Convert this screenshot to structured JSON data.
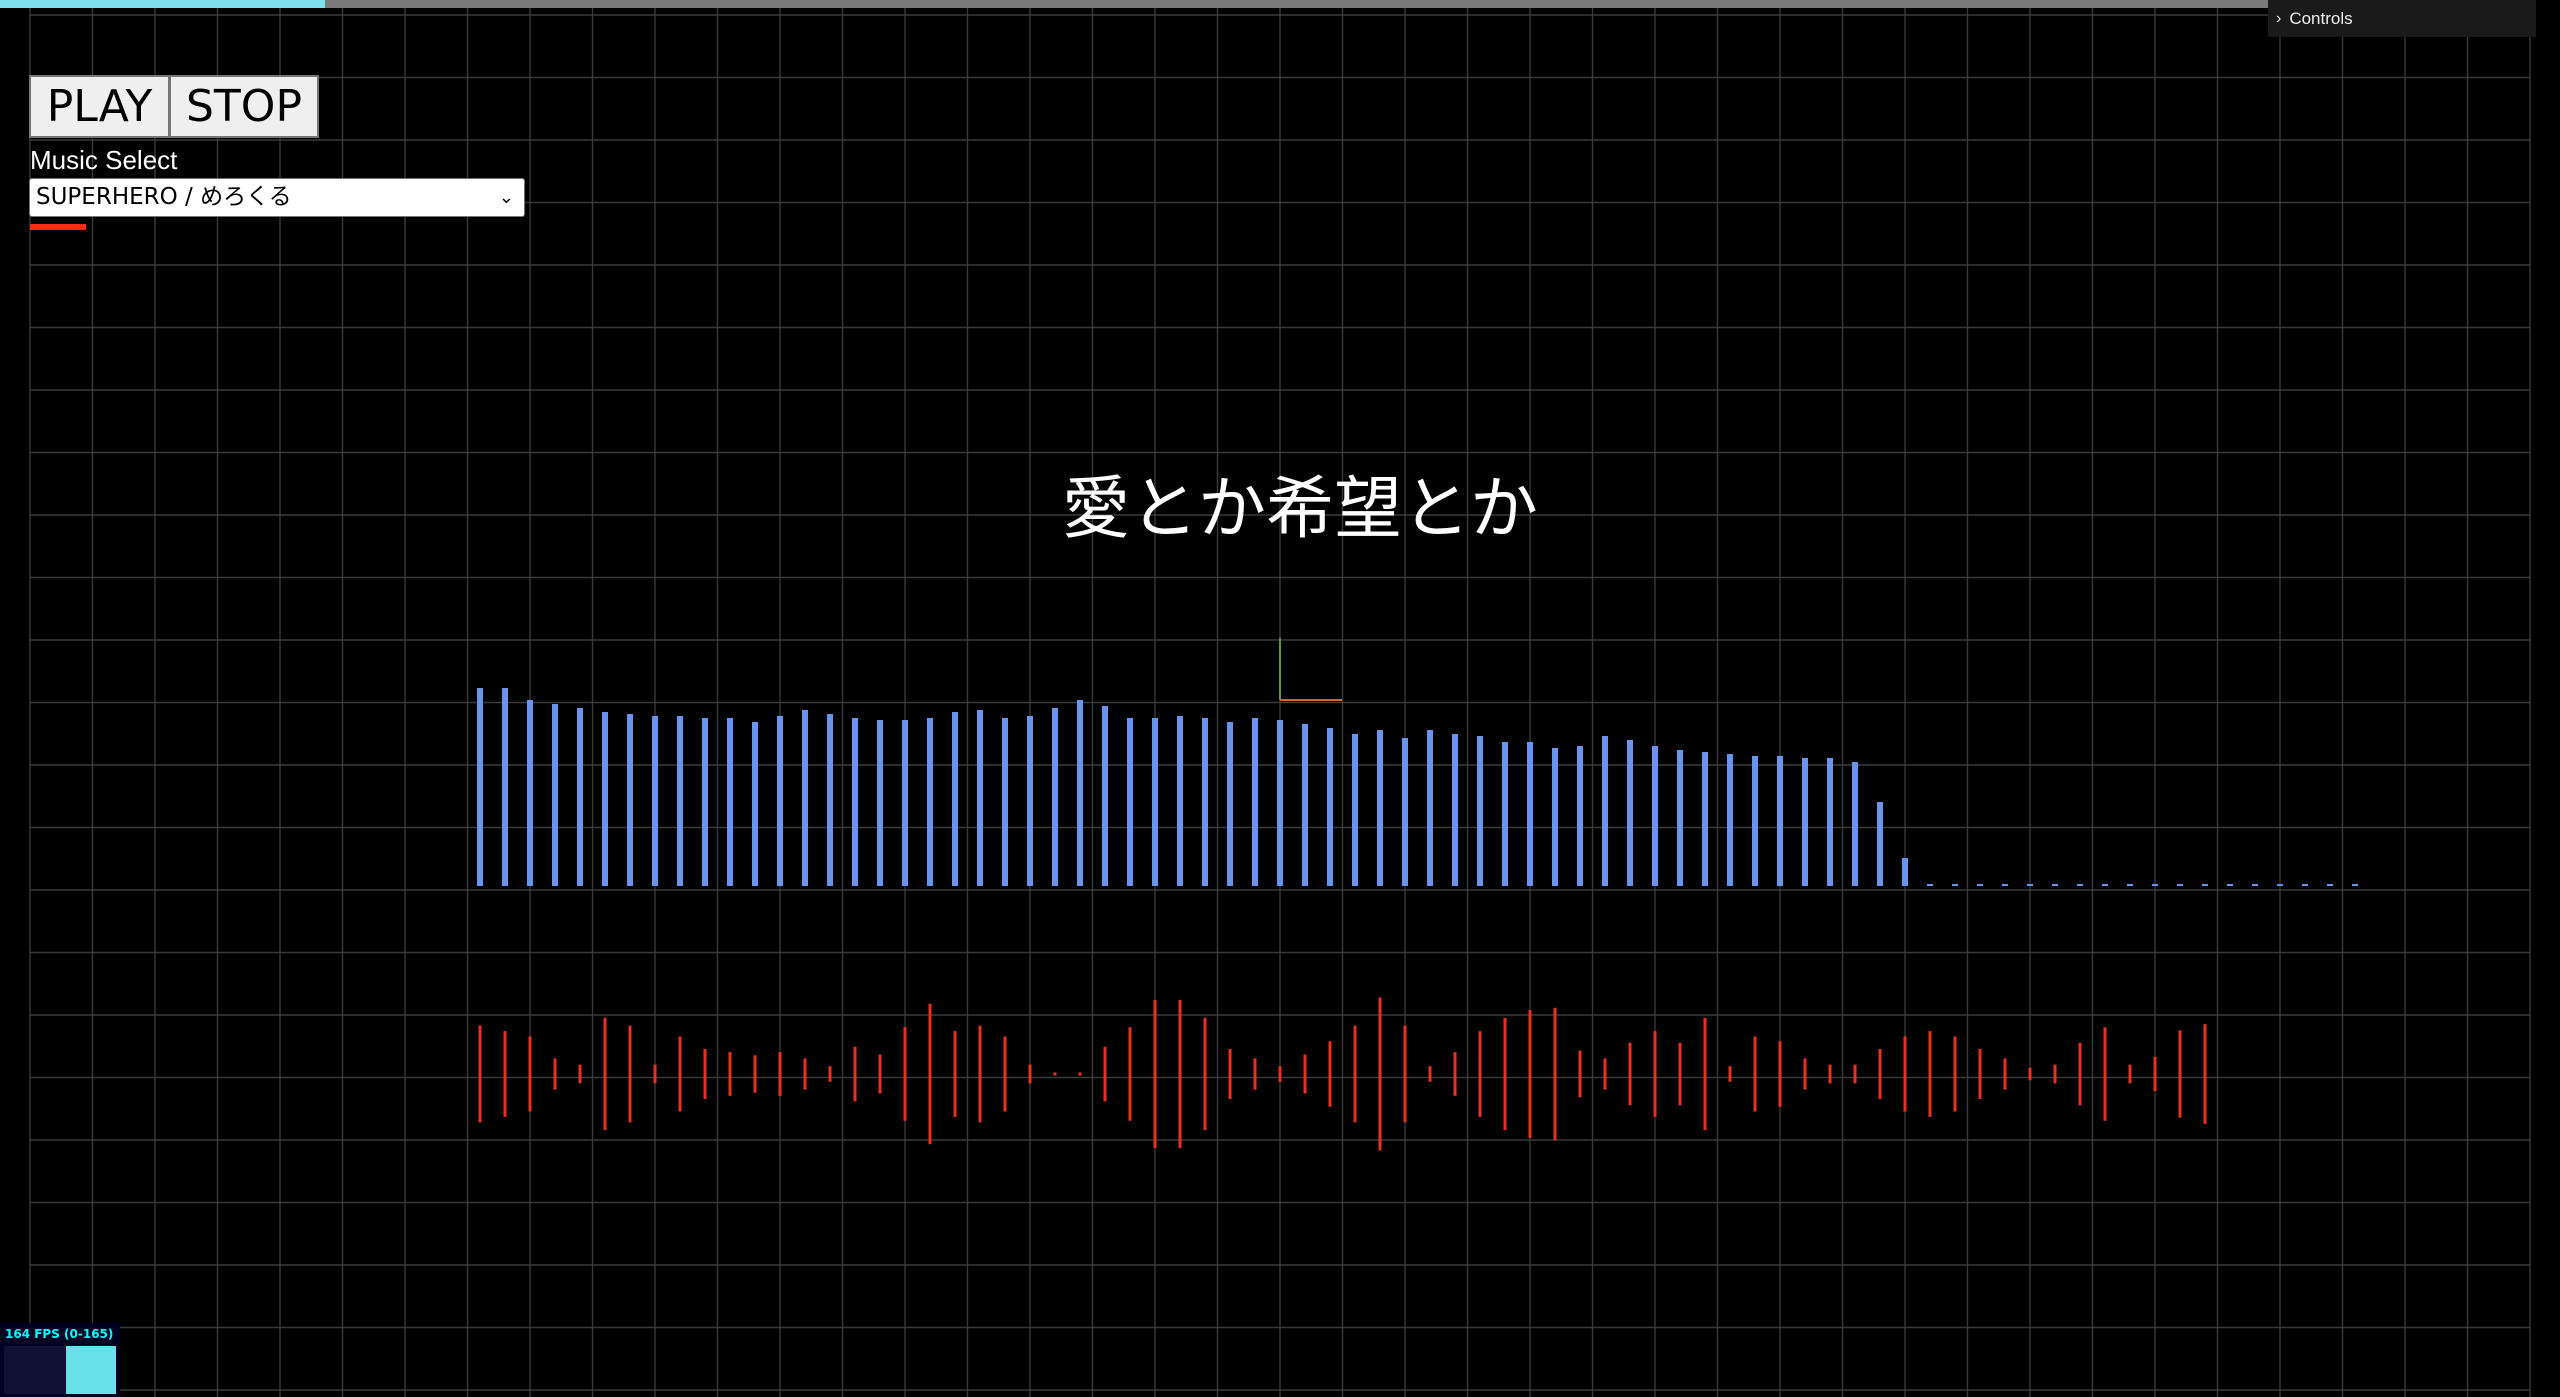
{
  "progress": {
    "fraction": 0.143,
    "fill_color": "#7fe0ee",
    "track_color": "#7a7a7a"
  },
  "controls": {
    "label": "Controls",
    "icon": "chevron-right-icon"
  },
  "buttons": {
    "play_label": "PLAY",
    "stop_label": "STOP"
  },
  "music": {
    "label": "Music Select",
    "selected": "SUPERHERO / めろくる",
    "icon": "chevron-down-icon"
  },
  "volume": {
    "color": "#ff2a1a"
  },
  "lyric": {
    "text": "愛とか希望とか"
  },
  "stats": {
    "text": "164 FPS (0-165)",
    "fps": 164,
    "min": 0,
    "max": 165
  },
  "spectrum": {
    "color": "#6b94ee",
    "levels": [
      0.99,
      0.99,
      0.93,
      0.91,
      0.89,
      0.87,
      0.86,
      0.85,
      0.85,
      0.84,
      0.84,
      0.82,
      0.85,
      0.88,
      0.86,
      0.84,
      0.83,
      0.83,
      0.84,
      0.87,
      0.88,
      0.84,
      0.85,
      0.89,
      0.93,
      0.9,
      0.84,
      0.84,
      0.85,
      0.84,
      0.82,
      0.84,
      0.83,
      0.81,
      0.79,
      0.76,
      0.78,
      0.74,
      0.78,
      0.76,
      0.75,
      0.72,
      0.72,
      0.69,
      0.7,
      0.75,
      0.73,
      0.7,
      0.68,
      0.67,
      0.66,
      0.65,
      0.65,
      0.64,
      0.64,
      0.62,
      0.42,
      0.14,
      0.01,
      0.01,
      0.01,
      0.01,
      0.01,
      0.01,
      0.01,
      0.01,
      0.01,
      0.01,
      0.01,
      0.01,
      0.01,
      0.01,
      0.01,
      0.01,
      0.01,
      0.01
    ]
  },
  "waveform": {
    "color": "#e8321e",
    "amplitudes": [
      0.62,
      0.55,
      0.48,
      0.2,
      0.12,
      0.72,
      0.62,
      0.12,
      0.48,
      0.32,
      0.28,
      0.24,
      0.28,
      0.2,
      0.1,
      0.35,
      0.25,
      0.6,
      0.9,
      0.55,
      0.62,
      0.48,
      0.12,
      0.02,
      0.02,
      0.35,
      0.6,
      0.95,
      0.95,
      0.72,
      0.32,
      0.2,
      0.1,
      0.25,
      0.42,
      0.62,
      0.98,
      0.62,
      0.1,
      0.28,
      0.55,
      0.72,
      0.82,
      0.85,
      0.3,
      0.2,
      0.4,
      0.55,
      0.4,
      0.72,
      0.1,
      0.48,
      0.42,
      0.2,
      0.12,
      0.12,
      0.32,
      0.48,
      0.55,
      0.48,
      0.32,
      0.2,
      0.08,
      0.12,
      0.4,
      0.6,
      0.12,
      0.22,
      0.56,
      0.64
    ]
  },
  "axes": {
    "y_color": "#5c9a37",
    "x_color": "#d4642a"
  }
}
